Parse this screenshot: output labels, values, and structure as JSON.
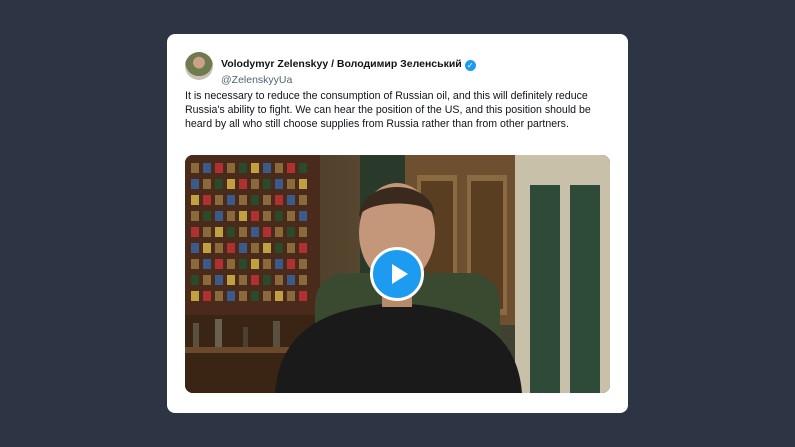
{
  "tweet": {
    "author_name": "Volodymyr Zelenskyy / Володимир Зеленський",
    "handle": "@ZelenskyyUa",
    "verified": true,
    "text": "It is necessary to reduce the consumption of Russian oil, and this will definitely reduce Russia's ability to fight. We can hear the position of the US, and this position should be heard by all who still choose supplies from Russia rather than from other partners."
  },
  "icons": {
    "verified": "verified-badge-icon",
    "play": "play-icon"
  },
  "colors": {
    "page_background": "#2d3444",
    "card_background": "#ffffff",
    "accent": "#1d9bf0",
    "text_primary": "#0f1419",
    "text_secondary": "#536471"
  }
}
